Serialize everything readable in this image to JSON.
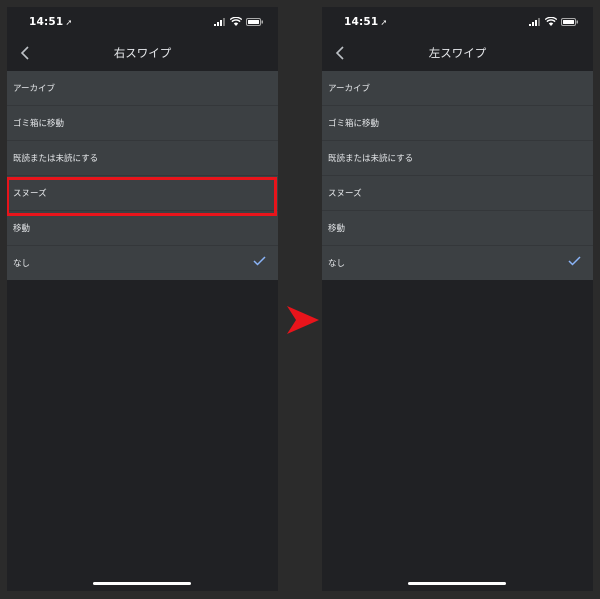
{
  "colors": {
    "phone_background": "#202124",
    "list_background": "#3c4043",
    "text": "#e8eaed",
    "check": "#8ab4f8",
    "highlight": "#e8141b"
  },
  "screens": [
    {
      "status_time": "14:51",
      "title": "右スワイプ",
      "options": [
        {
          "label": "アーカイブ",
          "selected": false
        },
        {
          "label": "ゴミ箱に移動",
          "selected": false
        },
        {
          "label": "既読または未読にする",
          "selected": false
        },
        {
          "label": "スヌーズ",
          "selected": false
        },
        {
          "label": "移動",
          "selected": false
        },
        {
          "label": "なし",
          "selected": true
        }
      ]
    },
    {
      "status_time": "14:51",
      "title": "左スワイプ",
      "options": [
        {
          "label": "アーカイブ",
          "selected": false
        },
        {
          "label": "ゴミ箱に移動",
          "selected": false
        },
        {
          "label": "既読または未読にする",
          "selected": false
        },
        {
          "label": "スヌーズ",
          "selected": false
        },
        {
          "label": "移動",
          "selected": false
        },
        {
          "label": "なし",
          "selected": true
        }
      ]
    }
  ],
  "icons": {
    "back": "chevron-left-icon",
    "check": "checkmark-icon",
    "arrow": "arrow-right-icon",
    "signal": "signal-icon",
    "wifi": "wifi-icon",
    "battery": "battery-icon",
    "location": "location-arrow-icon"
  }
}
